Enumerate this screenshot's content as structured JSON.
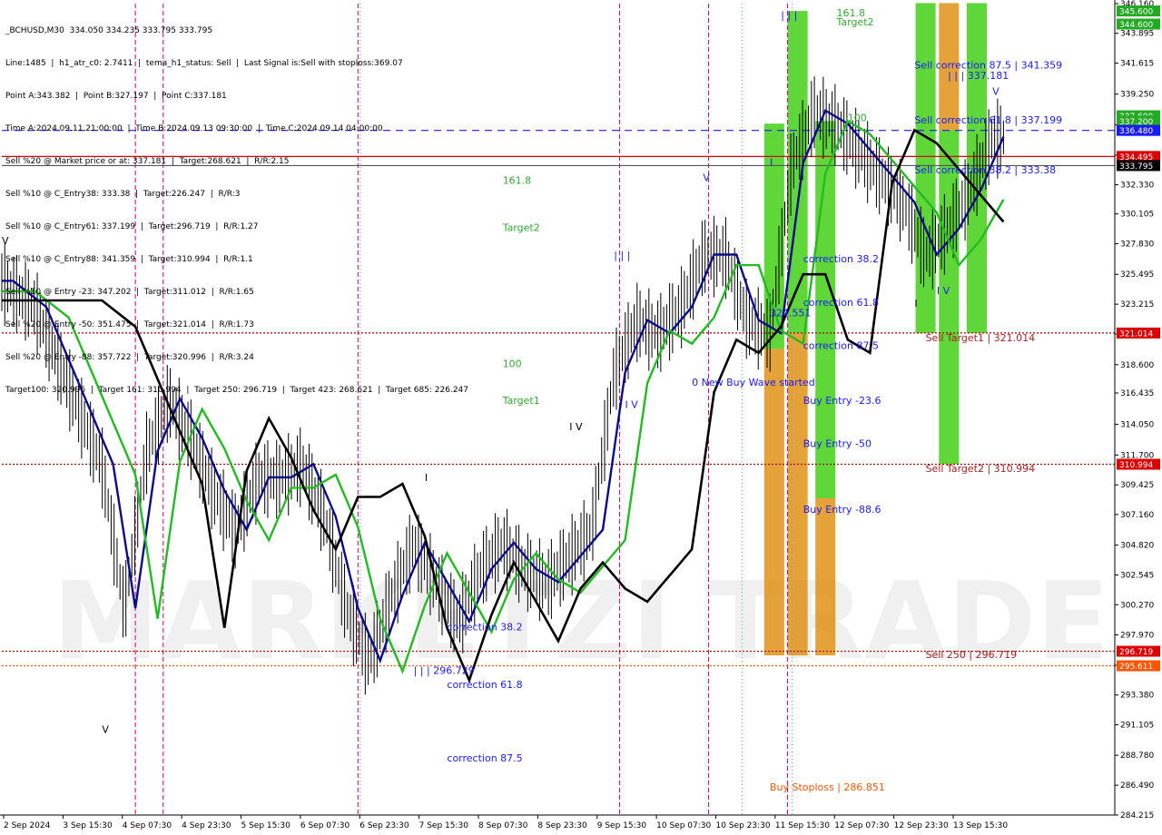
{
  "header": {
    "title": "_BCHUSD,M30  334.050 334.235 333.795 333.795",
    "lines": [
      "Line:1485  |  h1_atr_c0: 2.7411  |  tema_h1_status: Sell  |  Last Signal is:Sell with stoploss:369.07",
      "Point A:343.382  |  Point B:327.197  |  Point C:337.181",
      "Time A:2024.09.11 21:00:00  |  Time B:2024.09.13 09:30:00  |  Time C:2024.09.14 04:00:00",
      "Sell %20 @ Market price or at: 337.181  |  Target:268.621  |  R/R:2.15",
      "Sell %10 @ C_Entry38: 333.38  |  Target:226.247  |  R/R:3",
      "Sell %10 @ C_Entry61: 337.199  |  Target:296.719  |  R/R:1.27",
      "Sell %10 @ C_Entry88: 341.359  |  Target:310.994  |  R/R:1.1",
      "Sell %10 @ Entry -23: 347.202  |  Target:311.012  |  R/R:1.65",
      "Sell %20 @ Entry -50: 351.475  |  Target:321.014  |  R/R:1.73",
      "Sell %20 @ Entry -88: 357.722  |  Target:320.996  |  R/R:3.24",
      "Target100: 320.996  |  Target 161: 310.994  |  Target 250: 296.719  |  Target 423: 268.621  |  Target 685: 226.247"
    ]
  },
  "chart_data": {
    "type": "candlestick",
    "symbol": "_BCHUSD",
    "timeframe": "M30",
    "ohlc_last": {
      "open": 334.05,
      "high": 334.235,
      "low": 333.795,
      "close": 333.795
    },
    "y_ticks": [
      "346.160",
      "343.895",
      "341.615",
      "339.250",
      "336.910",
      "334.595",
      "332.330",
      "330.105",
      "327.830",
      "325.495",
      "323.215",
      "320.935",
      "318.600",
      "316.435",
      "314.050",
      "311.700",
      "309.425",
      "307.160",
      "304.820",
      "302.545",
      "300.270",
      "297.970",
      "295.650",
      "293.380",
      "291.105",
      "288.780",
      "286.490",
      "284.215"
    ],
    "ylim": [
      284.215,
      346.16
    ],
    "x_ticks": [
      "2 Sep 2024",
      "3 Sep 15:30",
      "4 Sep 07:30",
      "4 Sep 23:30",
      "5 Sep 15:30",
      "6 Sep 07:30",
      "6 Sep 23:30",
      "7 Sep 15:30",
      "8 Sep 07:30",
      "8 Sep 23:30",
      "9 Sep 15:30",
      "10 Sep 07:30",
      "10 Sep 23:30",
      "11 Sep 15:30",
      "12 Sep 07:30",
      "12 Sep 23:30",
      "13 Sep 15:30"
    ],
    "price_tags": [
      {
        "value": 345.6,
        "label": "345.600",
        "color": "#22aa22"
      },
      {
        "value": 344.6,
        "label": "344.600",
        "color": "#22aa22"
      },
      {
        "value": 337.6,
        "label": "337.600",
        "color": "#22aa22"
      },
      {
        "value": 337.2,
        "label": "337.200",
        "color": "#22aa22"
      },
      {
        "value": 336.48,
        "label": "336.480",
        "color": "#1a1aff"
      },
      {
        "value": 334.495,
        "label": "334.495",
        "color": "#dd0000"
      },
      {
        "value": 333.795,
        "label": "333.795",
        "color": "#000000"
      },
      {
        "value": 321.014,
        "label": "321.014",
        "color": "#dd0000"
      },
      {
        "value": 310.994,
        "label": "310.994",
        "color": "#dd0000"
      },
      {
        "value": 296.719,
        "label": "296.719",
        "color": "#dd0000"
      },
      {
        "value": 295.611,
        "label": "295.611",
        "color": "#ff5500"
      }
    ],
    "hlines": [
      {
        "value": 336.48,
        "color": "#1a1aff",
        "style": "dash"
      },
      {
        "value": 334.495,
        "color": "#dd0000",
        "style": "solid"
      },
      {
        "value": 333.795,
        "color": "#555555",
        "style": "solid"
      },
      {
        "value": 321.014,
        "color": "#aa0000",
        "style": "dot"
      },
      {
        "value": 310.994,
        "color": "#aa0000",
        "style": "dot"
      },
      {
        "value": 296.719,
        "color": "#aa0000",
        "style": "dot"
      },
      {
        "value": 295.611,
        "color": "#ff5500",
        "style": "dot"
      }
    ],
    "annotations": [
      {
        "text": "161.8",
        "x": 45,
        "y": 332.4,
        "color": "#33aa33"
      },
      {
        "text": "Target2",
        "x": 45,
        "y": 328.8,
        "color": "#33aa33"
      },
      {
        "text": "100",
        "x": 45,
        "y": 318.4,
        "color": "#33aa33"
      },
      {
        "text": "Target1",
        "x": 45,
        "y": 315.6,
        "color": "#33aa33"
      },
      {
        "text": "correction 38.2",
        "x": 40,
        "y": 298.3,
        "color": "#1a1aff"
      },
      {
        "text": "| | | 296.729",
        "x": 37,
        "y": 295.0,
        "color": "#1a1aff"
      },
      {
        "text": "correction 61.8",
        "x": 40,
        "y": 293.9,
        "color": "#1a1aff"
      },
      {
        "text": "correction 87.5",
        "x": 40,
        "y": 288.3,
        "color": "#1a1aff"
      },
      {
        "text": "0 New Buy Wave started",
        "x": 62,
        "y": 317.0,
        "color": "#1a1aff"
      },
      {
        "text": "324.551",
        "x": 69,
        "y": 322.3,
        "color": "#1a1aff"
      },
      {
        "text": "correction 38.2",
        "x": 72,
        "y": 326.4,
        "color": "#1a1aff"
      },
      {
        "text": "correction 61.8",
        "x": 72,
        "y": 323.1,
        "color": "#1a1aff"
      },
      {
        "text": "correction 87.5",
        "x": 72,
        "y": 319.8,
        "color": "#1a1aff"
      },
      {
        "text": "Buy Entry -23.6",
        "x": 72,
        "y": 315.6,
        "color": "#1a1aff"
      },
      {
        "text": "Buy Entry -50",
        "x": 72,
        "y": 312.3,
        "color": "#1a1aff"
      },
      {
        "text": "Buy Entry -88.6",
        "x": 72,
        "y": 307.3,
        "color": "#1a1aff"
      },
      {
        "text": "Buy Stoploss | 286.851",
        "x": 69,
        "y": 286.1,
        "color": "#ff5500"
      },
      {
        "text": "161.8",
        "x": 75,
        "y": 345.2,
        "color": "#33aa33"
      },
      {
        "text": "Target2",
        "x": 75,
        "y": 344.5,
        "color": "#33aa33"
      },
      {
        "text": "100",
        "x": 76,
        "y": 337.2,
        "color": "#33aa33"
      },
      {
        "text": "Sell correction 87.5 | 341.359",
        "x": 82,
        "y": 341.2,
        "color": "#1a1aff"
      },
      {
        "text": "| | | 337.181",
        "x": 85,
        "y": 340.4,
        "color": "#1a1aff"
      },
      {
        "text": "Sell correction 61.8 | 337.199",
        "x": 82,
        "y": 337.0,
        "color": "#1a1aff"
      },
      {
        "text": "Sell correction 38.2 | 333.38",
        "x": 82,
        "y": 333.2,
        "color": "#1a1aff"
      },
      {
        "text": "Sell Target1 | 321.014",
        "x": 83,
        "y": 320.4,
        "color": "#aa2222"
      },
      {
        "text": "Sell Target2 | 310.994",
        "x": 83,
        "y": 310.4,
        "color": "#aa2222"
      },
      {
        "text": "Sell 250 | 296.719",
        "x": 83,
        "y": 296.2,
        "color": "#aa2222"
      },
      {
        "text": "V",
        "x": 0,
        "y": 327.8,
        "color": "#000000"
      },
      {
        "text": "V",
        "x": 9,
        "y": 290.5,
        "color": "#000000"
      },
      {
        "text": "| | |",
        "x": 55,
        "y": 326.7,
        "color": "#1a1aff"
      },
      {
        "text": "I V",
        "x": 51,
        "y": 313.6,
        "color": "#000000"
      },
      {
        "text": "I V",
        "x": 56,
        "y": 315.3,
        "color": "#1a1aff"
      },
      {
        "text": "V",
        "x": 63,
        "y": 332.6,
        "color": "#1a1aff"
      },
      {
        "text": "I",
        "x": 69,
        "y": 333.8,
        "color": "#1a1aff"
      },
      {
        "text": "| | |",
        "x": 70,
        "y": 345.0,
        "color": "#1a1aff"
      },
      {
        "text": "I",
        "x": 38,
        "y": 309.7,
        "color": "#000000"
      },
      {
        "text": "I V",
        "x": 84,
        "y": 324.0,
        "color": "#1a1aff"
      },
      {
        "text": "I",
        "x": 82,
        "y": 323.0,
        "color": "#000000"
      },
      {
        "text": "V",
        "x": 89,
        "y": 339.2,
        "color": "#1a1aff"
      }
    ],
    "zones": [
      {
        "x0": 68.5,
        "x1": 70.3,
        "y0": 337.0,
        "y1": 319.8,
        "color": "#33cc00"
      },
      {
        "x0": 68.5,
        "x1": 70.3,
        "y0": 319.8,
        "y1": 296.4,
        "color": "#dd8800"
      },
      {
        "x0": 70.6,
        "x1": 72.4,
        "y0": 345.6,
        "y1": 321.0,
        "color": "#33cc00"
      },
      {
        "x0": 70.6,
        "x1": 72.4,
        "y0": 321.0,
        "y1": 296.4,
        "color": "#dd8800"
      },
      {
        "x0": 73.1,
        "x1": 74.9,
        "y0": 337.2,
        "y1": 308.4,
        "color": "#33cc00"
      },
      {
        "x0": 73.1,
        "x1": 74.9,
        "y0": 308.4,
        "y1": 296.4,
        "color": "#dd8800"
      },
      {
        "x0": 82.1,
        "x1": 83.9,
        "y0": 346.2,
        "y1": 321.0,
        "color": "#33cc00"
      },
      {
        "x0": 84.2,
        "x1": 86.0,
        "y0": 346.2,
        "y1": 336.5,
        "color": "#dd8800"
      },
      {
        "x0": 84.2,
        "x1": 86.0,
        "y0": 336.5,
        "y1": 311.0,
        "color": "#33cc00"
      },
      {
        "x0": 86.7,
        "x1": 88.5,
        "y0": 346.2,
        "y1": 321.0,
        "color": "#33cc00"
      }
    ],
    "vlines": [
      {
        "x": 12,
        "color": "#cc0077",
        "style": "dash"
      },
      {
        "x": 14.5,
        "color": "#cc0077",
        "style": "dash"
      },
      {
        "x": 32,
        "color": "#cc0077",
        "style": "dash"
      },
      {
        "x": 55.5,
        "color": "#cc0077",
        "style": "dash"
      },
      {
        "x": 63.5,
        "color": "#cc0077",
        "style": "dash"
      },
      {
        "x": 70.6,
        "color": "#cc0077",
        "style": "dash"
      },
      {
        "x": 32.2,
        "color": "#66aacc",
        "style": "dot"
      },
      {
        "x": 66.5,
        "color": "#66aacc",
        "style": "dot"
      },
      {
        "x": 71.0,
        "color": "#66aacc",
        "style": "dot"
      }
    ],
    "watermark": "MARKETZI TRADE",
    "legend_position": "top-left"
  }
}
